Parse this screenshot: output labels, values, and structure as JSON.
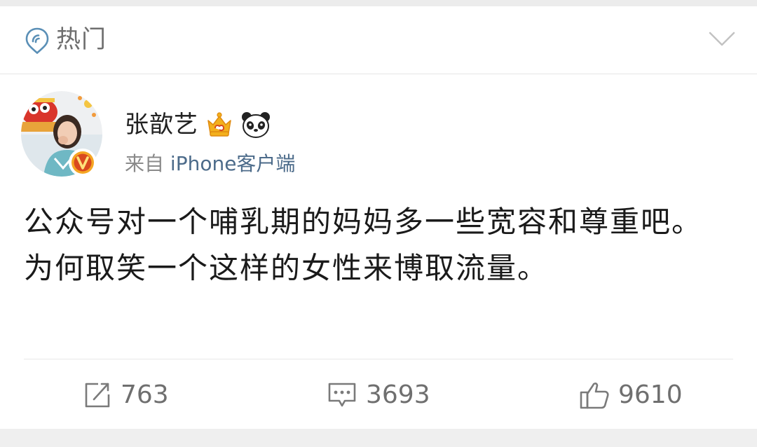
{
  "header": {
    "title": "热门",
    "icon": "location-pin-icon",
    "dropdown_icon": "chevron-down-icon"
  },
  "post": {
    "author": {
      "name": "张歆艺",
      "badges": [
        "crown-icon",
        "panda-icon"
      ],
      "verified_icon": "verified-v-icon"
    },
    "source": {
      "prefix": "来自",
      "client": "iPhone客户端"
    },
    "text": "公众号对一个哺乳期的妈妈多一些宽容和尊重吧。为何取笑一个这样的女性来博取流量。",
    "actions": {
      "repost_count": "763",
      "comment_count": "3693",
      "like_count": "9610"
    }
  },
  "colors": {
    "link_blue": "#4c6b8a",
    "text_primary": "#1a1a1a",
    "text_secondary": "#8a8a8a",
    "icon_gray": "#7a7a7a",
    "crown_gold": "#f3b01c",
    "verified_orange": "#f5a623"
  }
}
